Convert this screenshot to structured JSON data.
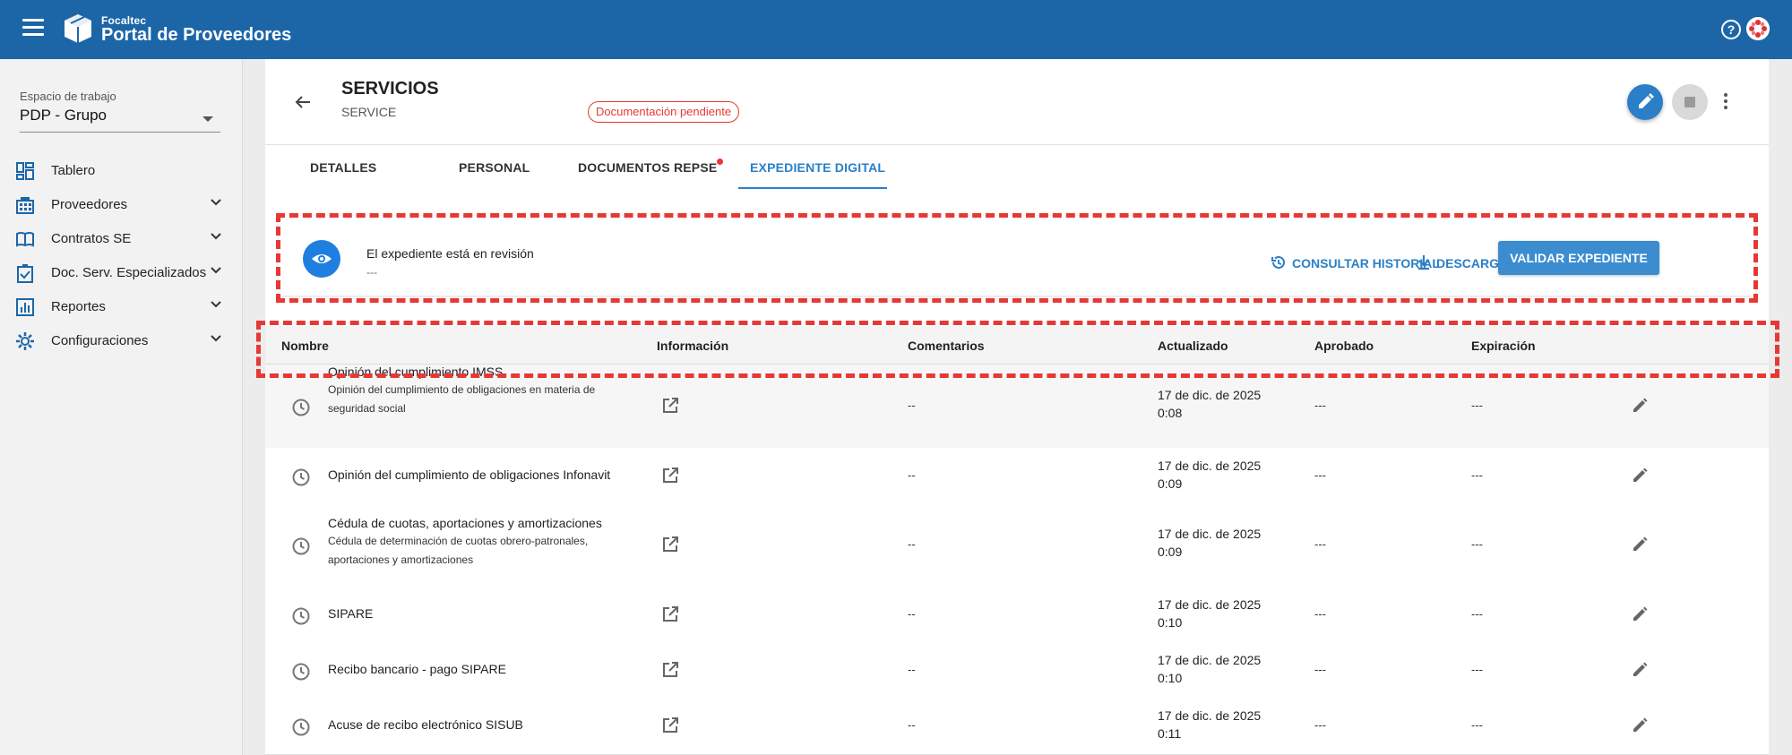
{
  "app": {
    "brand_small": "Focaltec",
    "brand_title": "Portal de Proveedores"
  },
  "sidebar": {
    "workspace_label": "Espacio de trabajo",
    "workspace_value": "PDP - Grupo",
    "items": [
      {
        "label": "Tablero",
        "icon": "dashboard-icon"
      },
      {
        "label": "Proveedores",
        "icon": "building-icon"
      },
      {
        "label": "Contratos SE",
        "icon": "book-icon"
      },
      {
        "label": "Doc. Serv. Especializados",
        "icon": "clipboard-check-icon"
      },
      {
        "label": "Reportes",
        "icon": "bar-chart-icon"
      },
      {
        "label": "Configuraciones",
        "icon": "gear-icon"
      }
    ]
  },
  "header": {
    "title": "SERVICIOS",
    "subtitle": "SERVICE",
    "status_badge": "Documentación pendiente"
  },
  "tabs": [
    {
      "label": "DETALLES",
      "active": false
    },
    {
      "label": "PERSONAL",
      "active": false
    },
    {
      "label": "DOCUMENTOS REPSE",
      "active": false
    },
    {
      "label": "EXPEDIENTE DIGITAL",
      "active": true
    }
  ],
  "review": {
    "title": "El expediente está en revisión",
    "subtitle": "---",
    "history_label": "CONSULTAR HISTORIAL",
    "download_label": "DESCARGAR",
    "validate_label": "VALIDAR EXPEDIENTE"
  },
  "table": {
    "columns": [
      "Nombre",
      "Información",
      "Comentarios",
      "Actualizado",
      "Aprobado",
      "Expiración"
    ],
    "rows": [
      {
        "name": "Opinión del cumplimiento IMSS",
        "desc_line1": "Opinión del cumplimiento de obligaciones en materia de",
        "desc_line2": "seguridad social",
        "comments": "--",
        "date_line1": "17 de dic. de 2025",
        "date_line2": "0:08",
        "approved": "---",
        "expiration": "---"
      },
      {
        "name": "Opinión del cumplimiento de obligaciones Infonavit",
        "desc_line1": "",
        "desc_line2": "",
        "comments": "--",
        "date_line1": "17 de dic. de 2025",
        "date_line2": "0:09",
        "approved": "---",
        "expiration": "---"
      },
      {
        "name": "Cédula de cuotas, aportaciones y amortizaciones",
        "desc_line1": "Cédula de determinación de cuotas obrero-patronales,",
        "desc_line2": "aportaciones y amortizaciones",
        "comments": "--",
        "date_line1": "17 de dic. de 2025",
        "date_line2": "0:09",
        "approved": "---",
        "expiration": "---"
      },
      {
        "name": "SIPARE",
        "desc_line1": "",
        "desc_line2": "",
        "comments": "--",
        "date_line1": "17 de dic. de 2025",
        "date_line2": "0:10",
        "approved": "---",
        "expiration": "---"
      },
      {
        "name": "Recibo bancario - pago SIPARE",
        "desc_line1": "",
        "desc_line2": "",
        "comments": "--",
        "date_line1": "17 de dic. de 2025",
        "date_line2": "0:10",
        "approved": "---",
        "expiration": "---"
      },
      {
        "name": "Acuse de recibo electrónico SISUB",
        "desc_line1": "",
        "desc_line2": "",
        "comments": "--",
        "date_line1": "17 de dic. de 2025",
        "date_line2": "0:11",
        "approved": "---",
        "expiration": "---"
      }
    ]
  },
  "colors": {
    "topbar": "#1c66a8",
    "accent": "#2a7fc7",
    "danger": "#e53935"
  }
}
